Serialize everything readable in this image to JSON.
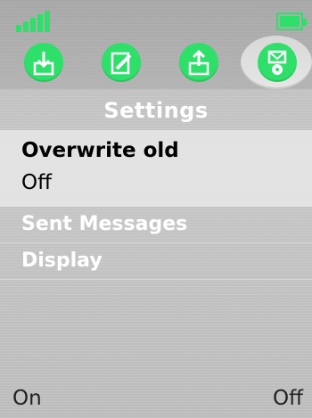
{
  "status": {
    "signal_icon": "signal-bars-icon",
    "battery_icon": "battery-icon",
    "accent_color": "#2ee06a"
  },
  "tabs": [
    {
      "icon": "inbox-download-icon"
    },
    {
      "icon": "edit-pencil-icon"
    },
    {
      "icon": "outbox-upload-icon"
    },
    {
      "icon": "message-settings-icon",
      "selected": true
    }
  ],
  "header": {
    "title": "Settings"
  },
  "setting": {
    "label": "Overwrite old",
    "value": "Off"
  },
  "menu": [
    {
      "label": "Sent Messages"
    },
    {
      "label": "Display"
    }
  ],
  "softkeys": {
    "left": "On",
    "right": "Off"
  }
}
